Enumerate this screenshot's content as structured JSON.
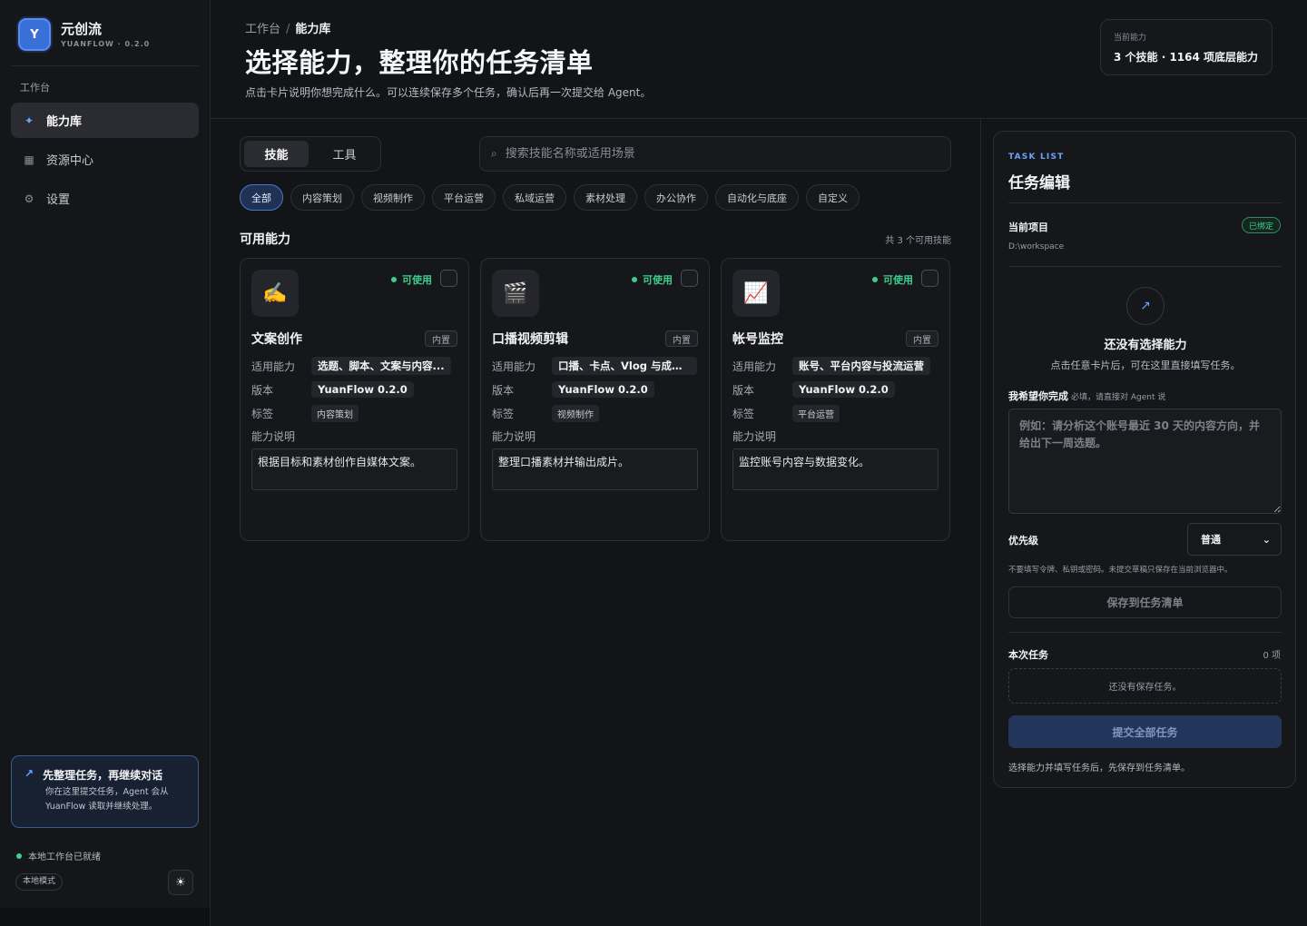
{
  "brand": {
    "logo_letter": "Y",
    "name": "元创流",
    "sub": "YUANFLOW · 0.2.0"
  },
  "sidebar": {
    "section": "工作台",
    "items": [
      {
        "label": "能力库",
        "icon": "sparkle-icon",
        "active": true
      },
      {
        "label": "资源中心",
        "icon": "grid-icon",
        "active": false
      },
      {
        "label": "设置",
        "icon": "gear-icon",
        "active": false
      }
    ],
    "tip": {
      "title": "先整理任务，再继续对话",
      "body": "你在这里提交任务，Agent 会从 YuanFlow 读取并继续处理。"
    },
    "status": "本地工作台已就绪",
    "mode": "本地模式"
  },
  "header": {
    "breadcrumb_root": "工作台",
    "breadcrumb_sep": "/",
    "breadcrumb_current": "能力库",
    "title": "选择能力，整理你的任务清单",
    "subtitle": "点击卡片说明你想完成什么。可以连续保存多个任务，确认后再一次提交给 Agent。",
    "capability_label": "当前能力",
    "capability_value": "3 个技能 · 1164 项底层能力"
  },
  "main": {
    "tabs": [
      {
        "label": "技能",
        "active": true
      },
      {
        "label": "工具",
        "active": false
      }
    ],
    "search": {
      "placeholder": "搜索技能名称或适用场景"
    },
    "filters": [
      {
        "label": "全部",
        "active": true
      },
      {
        "label": "内容策划"
      },
      {
        "label": "视频制作"
      },
      {
        "label": "平台运营"
      },
      {
        "label": "私域运营"
      },
      {
        "label": "素材处理"
      },
      {
        "label": "办公协作"
      },
      {
        "label": "自动化与底座"
      },
      {
        "label": "自定义"
      }
    ],
    "section_title": "可用能力",
    "section_count": "共 3 个可用技能",
    "cards": [
      {
        "icon": "✍️",
        "status": "可使用",
        "title": "文案创作",
        "badge": "内置",
        "k_ability": "适用能力",
        "ability": "选题、脚本、文案与内容...",
        "k_version": "版本",
        "version": "YuanFlow 0.2.0",
        "k_tags": "标签",
        "tag": "内容策划",
        "k_desc": "能力说明",
        "desc": "根据目标和素材创作自媒体文案。"
      },
      {
        "icon": "🎬",
        "status": "可使用",
        "title": "口播视频剪辑",
        "badge": "内置",
        "k_ability": "适用能力",
        "ability": "口播、卡点、Vlog 与成片...",
        "k_version": "版本",
        "version": "YuanFlow 0.2.0",
        "k_tags": "标签",
        "tag": "视频制作",
        "k_desc": "能力说明",
        "desc": "整理口播素材并输出成片。"
      },
      {
        "icon": "📈",
        "status": "可使用",
        "title": "帐号监控",
        "badge": "内置",
        "k_ability": "适用能力",
        "ability": "账号、平台内容与投流运营",
        "k_version": "版本",
        "version": "YuanFlow 0.2.0",
        "k_tags": "标签",
        "tag": "平台运营",
        "k_desc": "能力说明",
        "desc": "监控账号内容与数据变化。"
      }
    ]
  },
  "panel": {
    "eyebrow": "TASK LIST",
    "title": "任务编辑",
    "project_label": "当前项目",
    "project_badge": "已绑定",
    "project_path": "D:\\workspace",
    "empty_title": "还没有选择能力",
    "empty_sub": "点击任意卡片后，可在这里直接填写任务。",
    "want_label": "我希望你完成",
    "want_hint": "必填，请直接对 Agent 说",
    "want_placeholder": "例如：请分析这个账号最近 30 天的内容方向，并给出下一周选题。",
    "priority_label": "优先级",
    "priority_value": "普通",
    "note": "不要填写令牌、私钥或密码。未提交草稿只保存在当前浏览器中。",
    "save_label": "保存到任务清单",
    "tasks_label": "本次任务",
    "tasks_count": "0 项",
    "tasks_empty": "还没有保存任务。",
    "submit_label": "提交全部任务",
    "footer": "选择能力并填写任务后，先保存到任务清单。"
  }
}
